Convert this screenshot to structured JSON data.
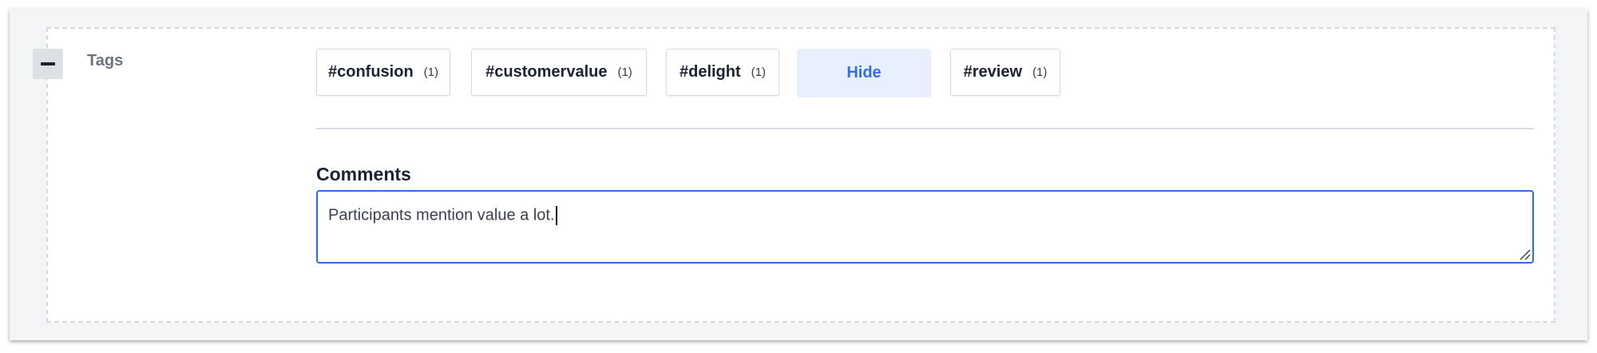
{
  "section": {
    "label": "Tags"
  },
  "tags": [
    {
      "name": "#confusion",
      "count": "(1)"
    },
    {
      "name": "#customervalue",
      "count": "(1)"
    },
    {
      "name": "#delight",
      "count": "(1)"
    },
    {
      "name": "#review",
      "count": "(1)"
    }
  ],
  "hide_label": "Hide",
  "comments": {
    "label": "Comments",
    "value": "Participants mention value a lot."
  },
  "colors": {
    "accent": "#2a6de0",
    "hide_bg": "#e8f0fe",
    "text_dark": "#1b2333",
    "label_gray": "#6b7380"
  },
  "icons": {
    "collapse": "minus-icon",
    "resize": "resize-handle-icon"
  }
}
